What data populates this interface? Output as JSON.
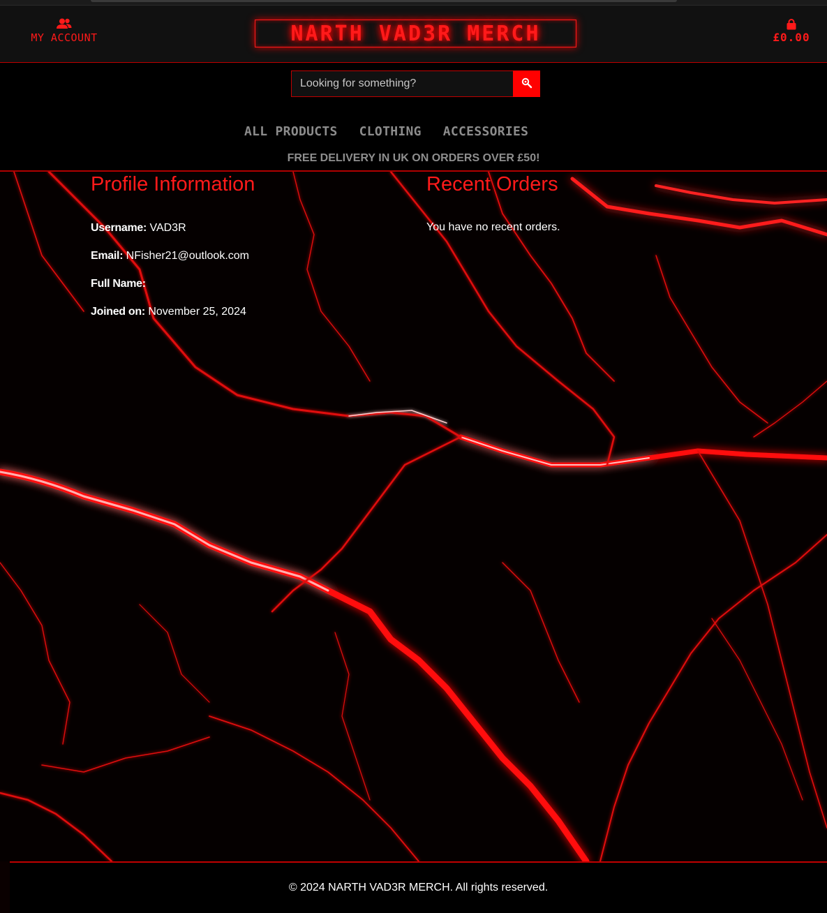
{
  "header": {
    "account_label": "MY ACCOUNT",
    "account_icon": "user-group-icon",
    "brand": "NARTH VAD3R MERCH",
    "cart_icon": "shopping-bag-icon",
    "cart_total": "£0.00",
    "accent_color": "#ff1a1a"
  },
  "search": {
    "placeholder": "Looking for something?",
    "value": "",
    "button_icon": "search-icon"
  },
  "nav": {
    "items": [
      {
        "label": "ALL PRODUCTS"
      },
      {
        "label": "CLOTHING"
      },
      {
        "label": "ACCESSORIES"
      }
    ]
  },
  "banner": {
    "delivery": "FREE DELIVERY IN UK ON ORDERS OVER £50!"
  },
  "profile": {
    "title": "Profile Information",
    "fields": [
      {
        "label": "Username:",
        "value": "VAD3R"
      },
      {
        "label": "Email:",
        "value": "NFisher21@outlook.com"
      },
      {
        "label": "Full Name:",
        "value": ""
      },
      {
        "label": "Joined on:",
        "value": "November 25, 2024"
      }
    ]
  },
  "orders": {
    "title": "Recent Orders",
    "empty_message": "You have no recent orders."
  },
  "footer": {
    "copyright": "© 2024 NARTH VAD3R MERCH. All rights reserved."
  }
}
